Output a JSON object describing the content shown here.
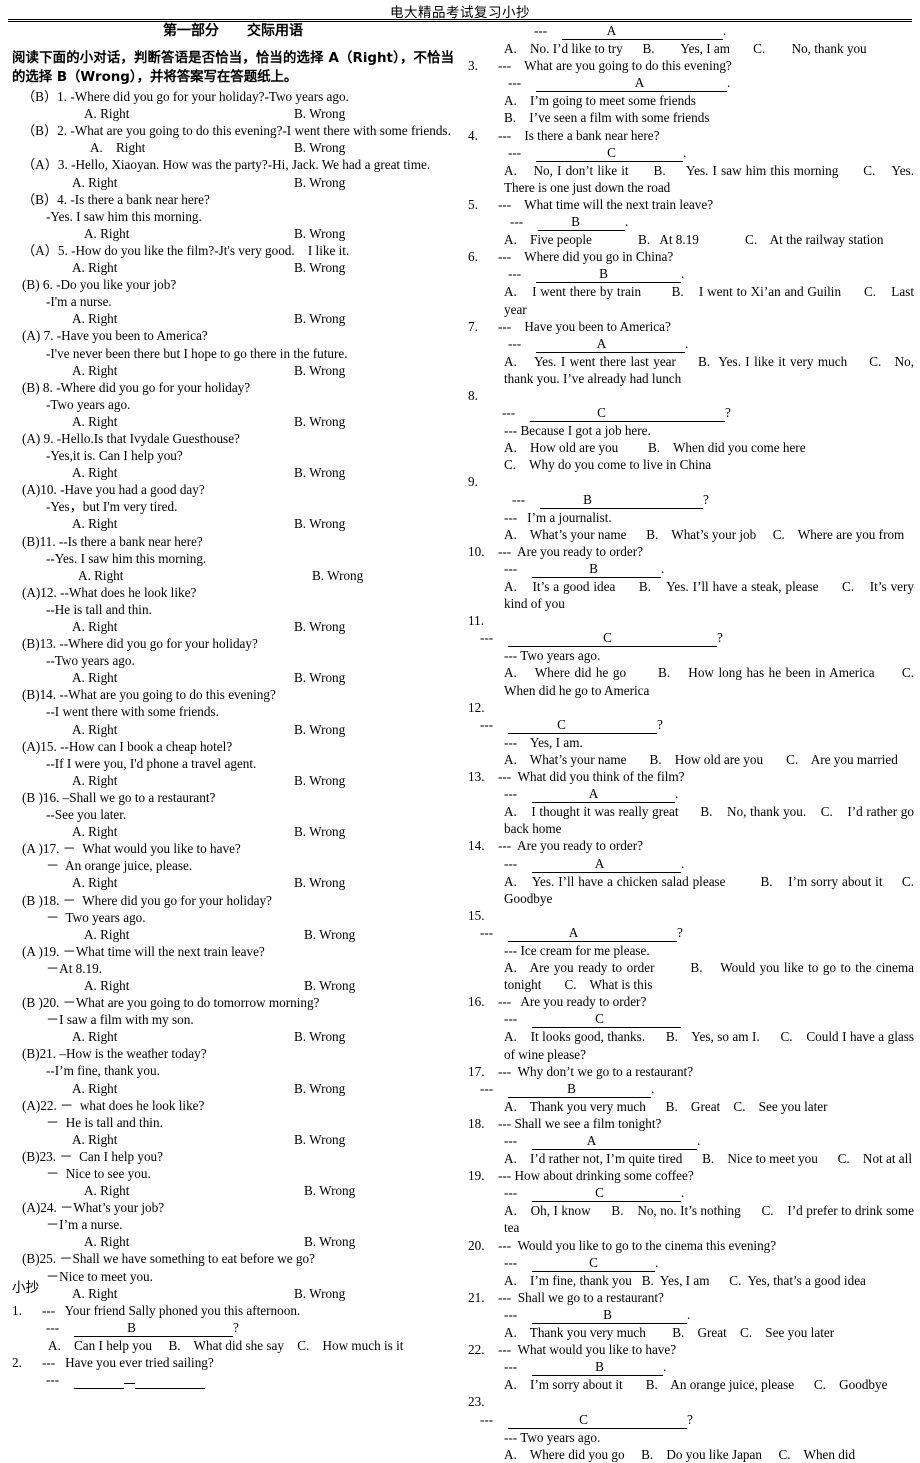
{
  "header": {
    "running_title": "电大精品考试复习小抄",
    "footer_mark": "小抄"
  },
  "left_column": {
    "part_title": "第一部分　　交际用语",
    "instruction": "阅读下面的小对话，判断答语是否恰当，恰当的选择 A（Right），不恰当的选择 B（Wrong），并将答案写在答题纸上。",
    "option_a_label": "A. Right",
    "option_b_label": "B. Wrong",
    "items": [
      {
        "key": "（B）1.",
        "question": "-Where did you go for your holiday?-Two years ago.",
        "reply": "",
        "opt_a": "A. Right",
        "opt_b": "B. Wrong"
      },
      {
        "key": "（B）2.",
        "question": "-What are you going to do this evening?-I went there with some friends.",
        "reply": "",
        "opt_a": "A.    Right",
        "opt_b": "B. Wrong"
      },
      {
        "key": "（A）3.",
        "question": "-Hello, Xiaoyan. How was the party?-Hi, Jack. We had a great time.",
        "reply": "",
        "opt_a": "A. Right",
        "opt_b": "B. Wrong"
      },
      {
        "key": "（B）4.",
        "question": "-Is there a bank near here?",
        "reply": "-Yes. I saw him this morning.",
        "opt_a": "A. Right",
        "opt_b": "B. Wrong"
      },
      {
        "key": "（A）5.",
        "question": "-How do you like the film?-Jt's very good.    I like it.",
        "reply": "",
        "opt_a": "A. Right",
        "opt_b": "B. Wrong"
      },
      {
        "key": "(B) 6.",
        "question": "-Do you like your job?",
        "reply": "-I'm a nurse.",
        "opt_a": "A. Right",
        "opt_b": "B. Wrong"
      },
      {
        "key": "(A) 7.",
        "question": "-Have you been to America?",
        "reply": "-I've never been there but I hope to go there in the future.",
        "opt_a": "A. Right",
        "opt_b": "B. Wrong"
      },
      {
        "key": "(B) 8.",
        "question": "-Where did you go for your holiday?",
        "reply": "-Two years ago.",
        "opt_a": "A. Right",
        "opt_b": "B. Wrong"
      },
      {
        "key": "(A) 9.",
        "question": "-Hello.Is that Ivydale Guesthouse?",
        "reply": "-Yes,it is. Can I help you?",
        "opt_a": "A. Right",
        "opt_b": "B. Wrong"
      },
      {
        "key": "(A)10.",
        "question": "-Have you had a good day?",
        "reply": "-Yes，but I'm very tired.",
        "opt_a": "A. Right",
        "opt_b": "B. Wrong"
      },
      {
        "key": "(B)11.",
        "question": "--Is there a bank near here?",
        "reply": "--Yes. I saw him this morning.",
        "opt_a": "A. Right",
        "opt_b": "B. Wrong"
      },
      {
        "key": "(A)12.",
        "question": "--What does he look like?",
        "reply": "--He is tall and thin.",
        "opt_a": "A. Right",
        "opt_b": "B. Wrong"
      },
      {
        "key": "(B)13.",
        "question": "--Where did you go for your holiday?",
        "reply": "--Two years ago.",
        "opt_a": "A. Right",
        "opt_b": "B. Wrong"
      },
      {
        "key": "(B)14.",
        "question": "--What are you going to do this evening?",
        "reply": "--I went there with some friends.",
        "opt_a": "A. Right",
        "opt_b": "B. Wrong"
      },
      {
        "key": "(A)15.",
        "question": "--How can I book a cheap hotel?",
        "reply": "--If I were you, I'd phone a travel agent.",
        "opt_a": "A. Right",
        "opt_b": "B. Wrong"
      },
      {
        "key": "(B )16.",
        "question": "–Shall we go to a restaurant?",
        "reply": "--See you later.",
        "opt_a": "A. Right",
        "opt_b": "B. Wrong"
      },
      {
        "key": "(A )17.",
        "question": "－  What would you like to have?",
        "reply": "－  An orange juice, please.",
        "opt_a": "A. Right",
        "opt_b": "B. Wrong"
      },
      {
        "key": "(B )18.",
        "question": "－  Where did you go for your holiday?",
        "reply": "－  Two years ago.",
        "opt_a": "A. Right",
        "opt_b": "B. Wrong"
      },
      {
        "key": "(A )19.",
        "question": "－What time will the next train leave?",
        "reply": "－At 8.19.",
        "opt_a": "A. Right",
        "opt_b": "B. Wrong"
      },
      {
        "key": "(B )20.",
        "question": "－What are you going to do tomorrow morning?",
        "reply": "－I saw a film with my son.",
        "opt_a": "A. Right",
        "opt_b": "B. Wrong"
      },
      {
        "key": "(B)21.",
        "question": "–How is the weather today?",
        "reply": "--I’m fine, thank you.",
        "opt_a": "A. Right",
        "opt_b": "B. Wrong"
      },
      {
        "key": "(A)22.",
        "question": "－  what does he look like?",
        "reply": "－  He is tall and thin.",
        "opt_a": "A. Right",
        "opt_b": "B. Wrong"
      },
      {
        "key": "(B)23.",
        "question": "－  Can I help you?",
        "reply": "－  Nice to see you.",
        "opt_a": "A. Right",
        "opt_b": "B. Wrong"
      },
      {
        "key": "(A)24.",
        "question": "－What’s your job?",
        "reply": "－I’m a nurse.",
        "opt_a": "A. Right",
        "opt_b": "B. Wrong"
      },
      {
        "key": "(B)25.",
        "question": "－Shall we have something to eat before we go?",
        "reply": "－Nice to meet you.",
        "opt_a": "A. Right",
        "opt_b": "B. Wrong"
      }
    ],
    "mc_items": [
      {
        "number": "1.",
        "prompt": "---   Your friend Sally phoned you this afternoon.",
        "answer_letter": "B",
        "blank_end": "?",
        "blank_pre_width": 52,
        "blank_post_width": 96,
        "options": "A.    Can I help you     B.    What did she say    C.    How much is it"
      },
      {
        "number": "2.",
        "prompt": "---   Have you ever tried sailing?",
        "answer_letter": "",
        "blank_end": "",
        "blank_pre_width": 0,
        "blank_post_width": 0,
        "options": ""
      }
    ]
  },
  "right_column": {
    "items": [
      {
        "number": "",
        "prompt": "",
        "answer_letter": "A",
        "blank_end": ".",
        "blank_pre_width": 44,
        "blank_post_width": 106,
        "blank_indent": 66,
        "options": "A.    No. I’d like to try      B.        Yes, I am       C.        No, thank you"
      },
      {
        "number": "3.",
        "prompt": "---    What are you going to do this evening?",
        "answer_letter": "A",
        "blank_end": ".",
        "blank_pre_width": 98,
        "blank_post_width": 82,
        "blank_indent": 40,
        "options": "A.    I’m going to meet some friends\nB.    I’ve seen a film with some friends"
      },
      {
        "number": "4.",
        "prompt": "---    Is there a bank near here?",
        "answer_letter": "C",
        "blank_end": ".",
        "blank_pre_width": 70,
        "blank_post_width": 66,
        "blank_indent": 40,
        "options": "A.    No, I don’t like it      B.     Yes. I saw him this morning      C.    Yes. There is one just down the road"
      },
      {
        "number": "5.",
        "prompt": "---    What time will the next train leave?",
        "answer_letter": "B",
        "blank_end": ".",
        "blank_pre_width": 32,
        "blank_post_width": 44,
        "blank_indent": 42,
        "options": "A.    Five people              B.   At 8.19              C.    At the railway station"
      },
      {
        "number": "6.",
        "prompt": "---    Where did you go in China?",
        "answer_letter": "B",
        "blank_end": ".",
        "blank_pre_width": 62,
        "blank_post_width": 72,
        "blank_indent": 40,
        "options": "A.    I went there by train        B.    I went to Xi’an and Guilin      C.    Last year"
      },
      {
        "number": "7.",
        "prompt": "---    Have you been to America?",
        "answer_letter": "A",
        "blank_end": ".",
        "blank_pre_width": 60,
        "blank_post_width": 78,
        "blank_indent": 40,
        "options": "A.    Yes. I went there last year     B.  Yes. I like it very much     C.   No, thank you. I’ve already had lunch"
      },
      {
        "number": "8.",
        "prompt": "",
        "answer_letter": "C",
        "blank_end": "?",
        "blank_pre_width": 66,
        "blank_post_width": 118,
        "blank_indent": 34,
        "reply_line": "--- Because I got a job here.",
        "options": "A.    How old are you         B.    When did you come here\nC.    Why do you come to live in China"
      },
      {
        "number": "9.",
        "prompt": "",
        "answer_letter": "B",
        "blank_end": "?",
        "blank_pre_width": 42,
        "blank_post_width": 110,
        "blank_indent": 44,
        "reply_line": "---   I’m a journalist.",
        "options": "A.    What’s your name      B.    What’s your job     C.    Where are you from"
      },
      {
        "number": "10.",
        "prompt": "---  Are you ready to order?",
        "answer_letter": "B",
        "blank_end": ".",
        "blank_pre_width": 56,
        "blank_post_width": 62,
        "blank_indent": 36,
        "options": "A.    It’s a good idea      B.    Yes. I’ll have a steak, please      C.    It’s very kind of you"
      },
      {
        "number": "11.",
        "prompt": "",
        "answer_letter": "C",
        "blank_end": "?",
        "blank_pre_width": 94,
        "blank_post_width": 104,
        "blank_indent": 12,
        "reply_line": "--- Two years ago.",
        "options": "A.    Where did he go       B.    How long has he been in America      C.    When did he go to America"
      },
      {
        "number": "12.",
        "prompt": "",
        "answer_letter": "C",
        "blank_end": "?",
        "blank_pre_width": 48,
        "blank_post_width": 90,
        "blank_indent": 12,
        "reply_line": "---    Yes, I am.",
        "options": "A.    What’s your name       B.    How old are you       C.    Are you married"
      },
      {
        "number": "13.",
        "prompt": "---  What did you think of the film?",
        "answer_letter": "A",
        "blank_end": ".",
        "blank_pre_width": 56,
        "blank_post_width": 76,
        "blank_indent": 36,
        "options": "A.    I thought it was really great      B.    No, thank you.    C.    I’d rather go back home"
      },
      {
        "number": "14.",
        "prompt": "---  Are you ready to order?",
        "answer_letter": "A",
        "blank_end": ".",
        "blank_pre_width": 62,
        "blank_post_width": 76,
        "blank_indent": 36,
        "options": "A.    Yes. I’ll have a chicken salad please         B.    I’m sorry about it     C.    Goodbye"
      },
      {
        "number": "15.",
        "prompt": "",
        "answer_letter": "A",
        "blank_end": "?",
        "blank_pre_width": 60,
        "blank_post_width": 98,
        "blank_indent": 12,
        "reply_line": "--- Ice cream for me please.",
        "options": "A.   Are you ready to order        B.    Would you like to go to the cinema tonight       C.    What is this"
      },
      {
        "number": "16.",
        "prompt": "---   Are you ready to order?",
        "answer_letter": "C",
        "blank_end": "",
        "blank_pre_width": 62,
        "blank_post_width": 76,
        "blank_indent": 36,
        "options": "A.    It looks good, thanks.      B.    Yes, so am I.      C.    Could I have a glass of wine please?"
      },
      {
        "number": "17.",
        "prompt": "---  Why don’t we go to a restaurant?",
        "answer_letter": "B",
        "blank_end": ".",
        "blank_pre_width": 58,
        "blank_post_width": 74,
        "blank_indent": 12,
        "options": "A.    Thank you very much      B.    Great    C.    See you later"
      },
      {
        "number": "18.",
        "prompt": "--- Shall we see a film tonight?",
        "answer_letter": "A",
        "blank_end": ".",
        "blank_pre_width": 54,
        "blank_post_width": 100,
        "blank_indent": 36,
        "options": "A.    I’d rather not, I’m quite tired      B.    Nice to meet you      C.    Not at all"
      },
      {
        "number": "19.",
        "prompt": "--- How about drinking some coffee?",
        "answer_letter": "C",
        "blank_end": ".",
        "blank_pre_width": 62,
        "blank_post_width": 76,
        "blank_indent": 36,
        "options": "A.    Oh, I know      B.    No, no. It’s nothing      C.    I’d prefer to drink some tea"
      },
      {
        "number": "20.",
        "prompt": "---  Would you like to go to the cinema this evening?",
        "answer_letter": "C",
        "blank_end": ".",
        "blank_pre_width": 56,
        "blank_post_width": 56,
        "blank_indent": 36,
        "options": "A.    I’m fine, thank you   B.  Yes, I am      C.  Yes, that’s a good idea"
      },
      {
        "number": "21.",
        "prompt": "---  Shall we go to a restaurant?",
        "answer_letter": "B",
        "blank_end": ".",
        "blank_pre_width": 70,
        "blank_post_width": 74,
        "blank_indent": 36,
        "options": "A.    Thank you very much        B.    Great    C.    See you later"
      },
      {
        "number": "22.",
        "prompt": "---  What would you like to have?",
        "answer_letter": "B",
        "blank_end": ".",
        "blank_pre_width": 62,
        "blank_post_width": 58,
        "blank_indent": 36,
        "options": "A.    I’m sorry about it       B.    An orange juice, please      C.    Goodbye"
      },
      {
        "number": "23.",
        "prompt": "",
        "answer_letter": "C",
        "blank_end": "?",
        "blank_pre_width": 70,
        "blank_post_width": 98,
        "blank_indent": 12,
        "reply_line": "--- Two years ago.",
        "options": "A.    Where did you go     B.    Do you like Japan     C.    When did"
      }
    ]
  }
}
